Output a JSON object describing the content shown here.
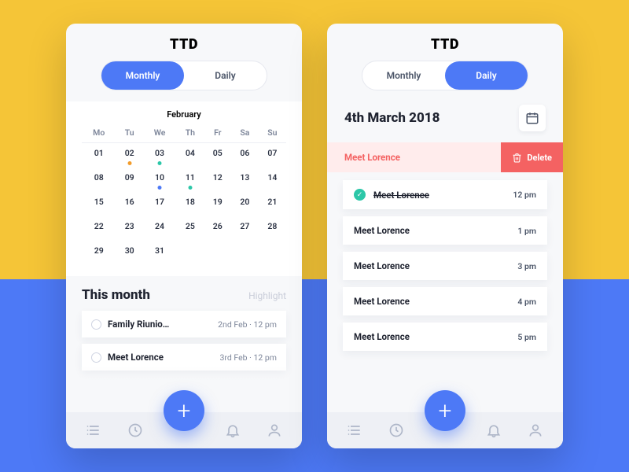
{
  "app": {
    "logo": "TTD"
  },
  "tabs": {
    "monthly": "Monthly",
    "daily": "Daily"
  },
  "monthly": {
    "month": "February",
    "weekdays": [
      "Mo",
      "Tu",
      "We",
      "Th",
      "Fr",
      "Sa",
      "Su"
    ],
    "grid": [
      [
        {
          "d": "01"
        },
        {
          "d": "02",
          "dot": "o"
        },
        {
          "d": "03",
          "dot": "g"
        },
        {
          "d": "04"
        },
        {
          "d": "05"
        },
        {
          "d": "06"
        },
        {
          "d": "07"
        }
      ],
      [
        {
          "d": "08"
        },
        {
          "d": "09"
        },
        {
          "d": "10",
          "dot": "b"
        },
        {
          "d": "11",
          "dot": "g"
        },
        {
          "d": "12"
        },
        {
          "d": "13"
        },
        {
          "d": "14"
        }
      ],
      [
        {
          "d": "15"
        },
        {
          "d": "16"
        },
        {
          "d": "17"
        },
        {
          "d": "18"
        },
        {
          "d": "19"
        },
        {
          "d": "20"
        },
        {
          "d": "21"
        }
      ],
      [
        {
          "d": "22"
        },
        {
          "d": "23"
        },
        {
          "d": "24"
        },
        {
          "d": "25"
        },
        {
          "d": "26"
        },
        {
          "d": "27"
        },
        {
          "d": "28"
        }
      ],
      [
        {
          "d": "29"
        },
        {
          "d": "30"
        },
        {
          "d": "31"
        },
        {
          "d": ""
        },
        {
          "d": ""
        },
        {
          "d": ""
        },
        {
          "d": ""
        }
      ]
    ],
    "section_title": "This month",
    "section_fade": "Highlight",
    "events": [
      {
        "title": "Family Riunio…",
        "meta": "2nd Feb  ·  12 pm"
      },
      {
        "title": "Meet Lorence",
        "meta": "3rd Feb  ·  12 pm"
      }
    ]
  },
  "daily": {
    "date_title": "4th March 2018",
    "swipe": {
      "label": "Meet Lorence",
      "delete": "Delete"
    },
    "rows": [
      {
        "title": "Meet Lorence",
        "time": "12 pm",
        "done": true
      },
      {
        "title": "Meet Lorence",
        "time": "1 pm",
        "done": false
      },
      {
        "title": "Meet Lorence",
        "time": "3 pm",
        "done": false
      },
      {
        "title": "Meet Lorence",
        "time": "4 pm",
        "done": false
      },
      {
        "title": "Meet Lorence",
        "time": "5 pm",
        "done": false
      }
    ]
  },
  "fab": "+"
}
